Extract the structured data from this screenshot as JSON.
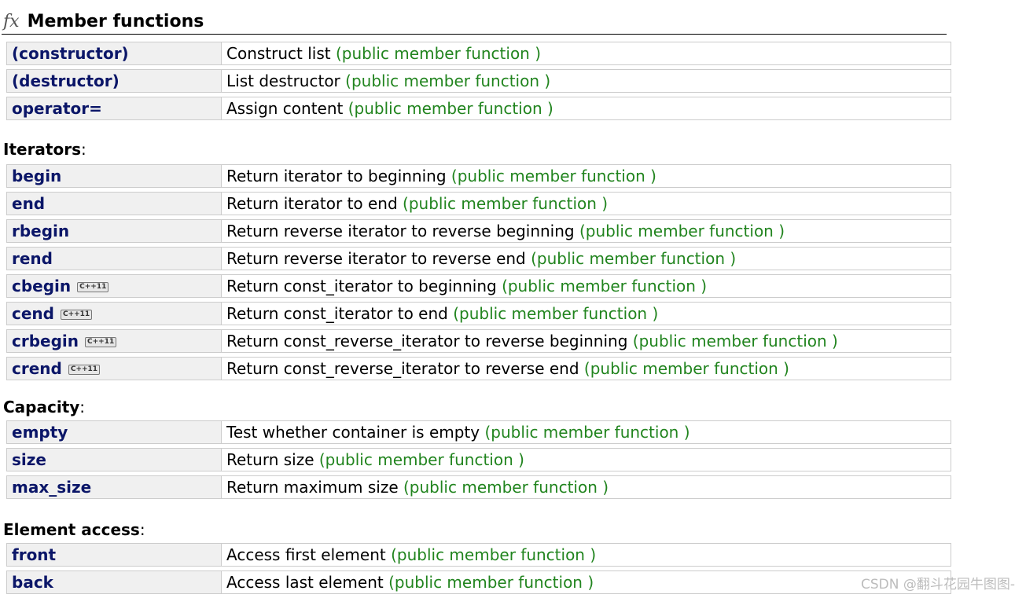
{
  "header": {
    "icon": "fx-icon",
    "title": "Member functions"
  },
  "kind_label": "(public member function )",
  "sections": [
    {
      "label": "",
      "rows": [
        {
          "name": "(constructor)",
          "desc": "Construct list",
          "kind": "(public member function )"
        },
        {
          "name": "(destructor)",
          "desc": "List destructor",
          "kind": "(public member function )"
        },
        {
          "name": "operator=",
          "desc": "Assign content",
          "kind": "(public member function )"
        }
      ]
    },
    {
      "label": "Iterators",
      "rows": [
        {
          "name": "begin",
          "desc": "Return iterator to beginning",
          "kind": "(public member function )"
        },
        {
          "name": "end",
          "desc": "Return iterator to end",
          "kind": "(public member function )"
        },
        {
          "name": "rbegin",
          "desc": "Return reverse iterator to reverse beginning",
          "kind": "(public member function )"
        },
        {
          "name": "rend",
          "desc": "Return reverse iterator to reverse end",
          "kind": "(public member function )"
        },
        {
          "name": "cbegin",
          "badge": "C++11",
          "desc": "Return const_iterator to beginning",
          "kind": "(public member function )"
        },
        {
          "name": "cend",
          "badge": "C++11",
          "desc": "Return const_iterator to end",
          "kind": "(public member function )"
        },
        {
          "name": "crbegin",
          "badge": "C++11",
          "desc": "Return const_reverse_iterator to reverse beginning",
          "kind": "(public member function )"
        },
        {
          "name": "crend",
          "badge": "C++11",
          "desc": "Return const_reverse_iterator to reverse end",
          "kind": "(public member function )"
        }
      ]
    },
    {
      "label": "Capacity",
      "rows": [
        {
          "name": "empty",
          "desc": "Test whether container is empty",
          "kind": "(public member function )"
        },
        {
          "name": "size",
          "desc": "Return size",
          "kind": "(public member function )"
        },
        {
          "name": "max_size",
          "desc": "Return maximum size",
          "kind": "(public member function )"
        }
      ]
    },
    {
      "label": "Element access",
      "rows": [
        {
          "name": "front",
          "desc": "Access first element",
          "kind": "(public member function )"
        },
        {
          "name": "back",
          "desc": "Access last element",
          "kind": "(public member function )"
        }
      ]
    }
  ],
  "watermark": "CSDN @翻斗花园牛图图-",
  "colors": {
    "name_text": "#0b1668",
    "kind_text": "#21841e",
    "name_cell_bg": "#f0f0f0",
    "border": "#cccccc"
  }
}
